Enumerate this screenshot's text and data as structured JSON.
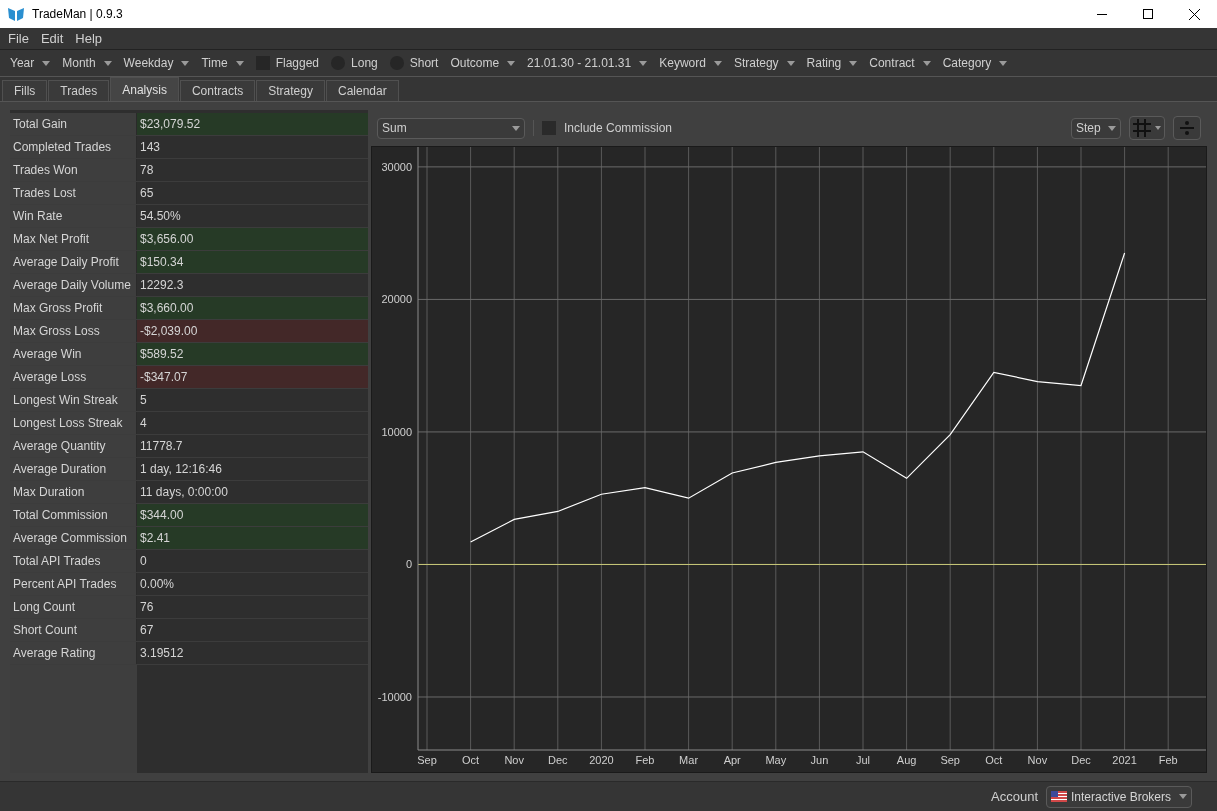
{
  "window": {
    "title": "TradeMan | 0.9.3"
  },
  "menu": [
    "File",
    "Edit",
    "Help"
  ],
  "filters": [
    {
      "kind": "dropdown",
      "label": "Year"
    },
    {
      "kind": "dropdown",
      "label": "Month"
    },
    {
      "kind": "dropdown",
      "label": "Weekday"
    },
    {
      "kind": "dropdown",
      "label": "Time"
    },
    {
      "kind": "checkbox",
      "label": "Flagged",
      "checked": false
    },
    {
      "kind": "radio",
      "label": "Long",
      "selected": false
    },
    {
      "kind": "radio",
      "label": "Short",
      "selected": false
    },
    {
      "kind": "dropdown",
      "label": "Outcome"
    },
    {
      "kind": "dropdown",
      "label": "21.01.30 - 21.01.31"
    },
    {
      "kind": "dropdown",
      "label": "Keyword"
    },
    {
      "kind": "dropdown",
      "label": "Strategy"
    },
    {
      "kind": "dropdown",
      "label": "Rating"
    },
    {
      "kind": "dropdown",
      "label": "Contract"
    },
    {
      "kind": "dropdown",
      "label": "Category"
    }
  ],
  "tabs": [
    {
      "label": "Fills",
      "selected": false
    },
    {
      "label": "Trades",
      "selected": false
    },
    {
      "label": "Analysis",
      "selected": true
    },
    {
      "label": "Contracts",
      "selected": false
    },
    {
      "label": "Strategy",
      "selected": false
    },
    {
      "label": "Calendar",
      "selected": false
    }
  ],
  "stats": [
    {
      "label": "Total Gain",
      "value": "$23,079.52",
      "color": "#263a26"
    },
    {
      "label": "Completed Trades",
      "value": "143"
    },
    {
      "label": "Trades Won",
      "value": "78"
    },
    {
      "label": "Trades Lost",
      "value": "65"
    },
    {
      "label": "Win Rate",
      "value": "54.50%"
    },
    {
      "label": "Max Net Profit",
      "value": "$3,656.00",
      "color": "#263a26"
    },
    {
      "label": "Average Daily Profit",
      "value": "$150.34",
      "color": "#263a26"
    },
    {
      "label": "Average Daily Volume",
      "value": "12292.3"
    },
    {
      "label": "Max Gross Profit",
      "value": "$3,660.00",
      "color": "#263a26"
    },
    {
      "label": "Max Gross Loss",
      "value": "-$2,039.00",
      "color": "#432828"
    },
    {
      "label": "Average Win",
      "value": "$589.52",
      "color": "#263a26"
    },
    {
      "label": "Average Loss",
      "value": "-$347.07",
      "color": "#432828"
    },
    {
      "label": "Longest Win Streak",
      "value": "5"
    },
    {
      "label": "Longest Loss Streak",
      "value": "4"
    },
    {
      "label": "Average Quantity",
      "value": "11778.7"
    },
    {
      "label": "Average Duration",
      "value": "1 day, 12:16:46"
    },
    {
      "label": "Max Duration",
      "value": "11 days, 0:00:00"
    },
    {
      "label": "Total Commission",
      "value": "$344.00",
      "color": "#263a26"
    },
    {
      "label": "Average Commission",
      "value": "$2.41",
      "color": "#263a26"
    },
    {
      "label": "Total API Trades",
      "value": "0"
    },
    {
      "label": "Percent API Trades",
      "value": "0.00%"
    },
    {
      "label": "Long Count",
      "value": "76"
    },
    {
      "label": "Short Count",
      "value": "67"
    },
    {
      "label": "Average Rating",
      "value": "3.19512"
    }
  ],
  "chart_toolbar": {
    "mode": "Sum",
    "include_commission": {
      "label": "Include Commission",
      "checked": false
    },
    "style": "Step"
  },
  "chart": {
    "chart_data": {
      "type": "line",
      "categories": [
        "Sep",
        "Oct",
        "Nov",
        "Dec",
        "2020",
        "Feb",
        "Mar",
        "Apr",
        "May",
        "Jun",
        "Jul",
        "Aug",
        "Sep",
        "Oct",
        "Nov",
        "Dec",
        "2021",
        "Feb"
      ],
      "series": [
        {
          "color": "#ffffff",
          "values": [
            null,
            1700,
            3400,
            4000,
            5300,
            5800,
            5000,
            6900,
            7700,
            8200,
            8500,
            6500,
            9800,
            14500,
            13800,
            13500,
            23500,
            null
          ]
        }
      ],
      "ylim": [
        -14000,
        31500
      ],
      "yticks": [
        -10000,
        0,
        10000,
        20000,
        30000
      ],
      "grid": true,
      "ref_lines": [
        {
          "axis": "y",
          "value": 0,
          "color": "#c8c878"
        }
      ]
    }
  },
  "status_bar": {
    "account_label": "Account",
    "account": "Interactive Brokers"
  }
}
